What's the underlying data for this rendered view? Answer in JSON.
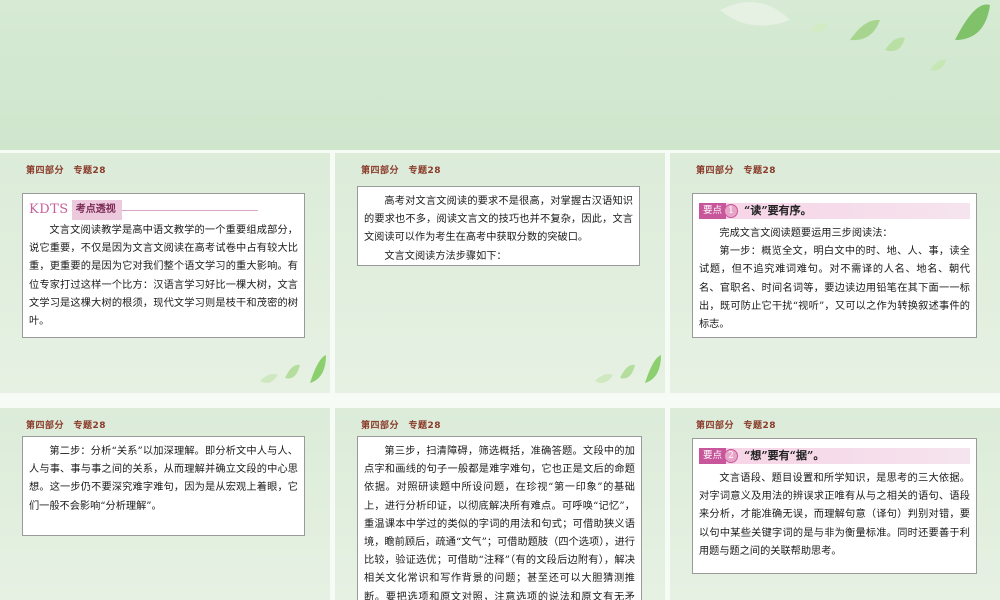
{
  "header_label": "第四部分　专题28",
  "slides": {
    "s1": {
      "logo": "KDTS",
      "tag": "考点透视",
      "paragraphs": [
        "文言文阅读教学是高中语文教学的一个重要组成部分，说它重要，不仅是因为文言文阅读在高考试卷中占有较大比重，更重要的是因为它对我们整个语文学习的重大影响。有位专家打过这样一个比方：汉语言学习好比一棵大树，文言文学习是这棵大树的根须，现代文学习则是枝干和茂密的树叶。"
      ]
    },
    "s2": {
      "paragraphs": [
        "高考对文言文阅读的要求不是很高，对掌握古汉语知识的要求也不多，阅读文言文的技巧也并不复杂，因此，文言文阅读可以作为考生在高考中获取分数的突破口。",
        "文言文阅读方法步骤如下："
      ]
    },
    "s3": {
      "badge": "要点",
      "num": "1",
      "title": "“读”要有序。",
      "paragraphs": [
        "完成文言文阅读题要运用三步阅读法：",
        "第一步：概览全文，明白文中的时、地、人、事，读全试题，但不追究难词难句。对不需译的人名、地名、朝代名、官职名、时间名词等，要边读边用铅笔在其下面一一标出，既可防止它干扰“视听”，又可以之作为转换叙述事件的标志。"
      ]
    },
    "s4": {
      "paragraphs": [
        "第二步：分析“关系”以加深理解。即分析文中人与人、人与事、事与事之间的关系，从而理解并确立文段的中心思想。这一步仍不要深究难字难句，因为是从宏观上着眼，它们一般不会影响“分析理解”。"
      ]
    },
    "s5": {
      "paragraphs": [
        "第三步，扫清障碍，筛选概括，准确答题。文段中的加点字和画线的句子一般都是难字难句，它也正是文后的命题依据。对照研读题中所设问题，在珍视“第一印象”的基础上，进行分析印证，以彻底解决所有难点。可呼唤“记忆”，重温课本中学过的类似的字词的用法和句式；可借助狭义语境，瞻前顾后，疏通“文气”；可借助题肢（四个选项），进行比较，验证选优；可借助“注释”（有的文段后边附有），解决相关文化常识和写作背景的问题；甚至还可以大胆猜测推断。要把选项和原文对照，注意选项的说法和原文有无矛盾，有无以偏赅全，有无无中生有，"
      ]
    },
    "s6": {
      "badge": "要点",
      "num": "2",
      "title": "“想”要有“据”。",
      "paragraphs": [
        "文言语段、题目设置和所学知识，是思考的三大依据。对字词意义及用法的辨误求正唯有从与之相关的语句、语段来分析，才能准确无误，而理解句意（译句）判别对错，要以句中某些关键字词的是与非为衡量标准。同时还要善于利用题与题之间的关联帮助思考。"
      ]
    }
  }
}
